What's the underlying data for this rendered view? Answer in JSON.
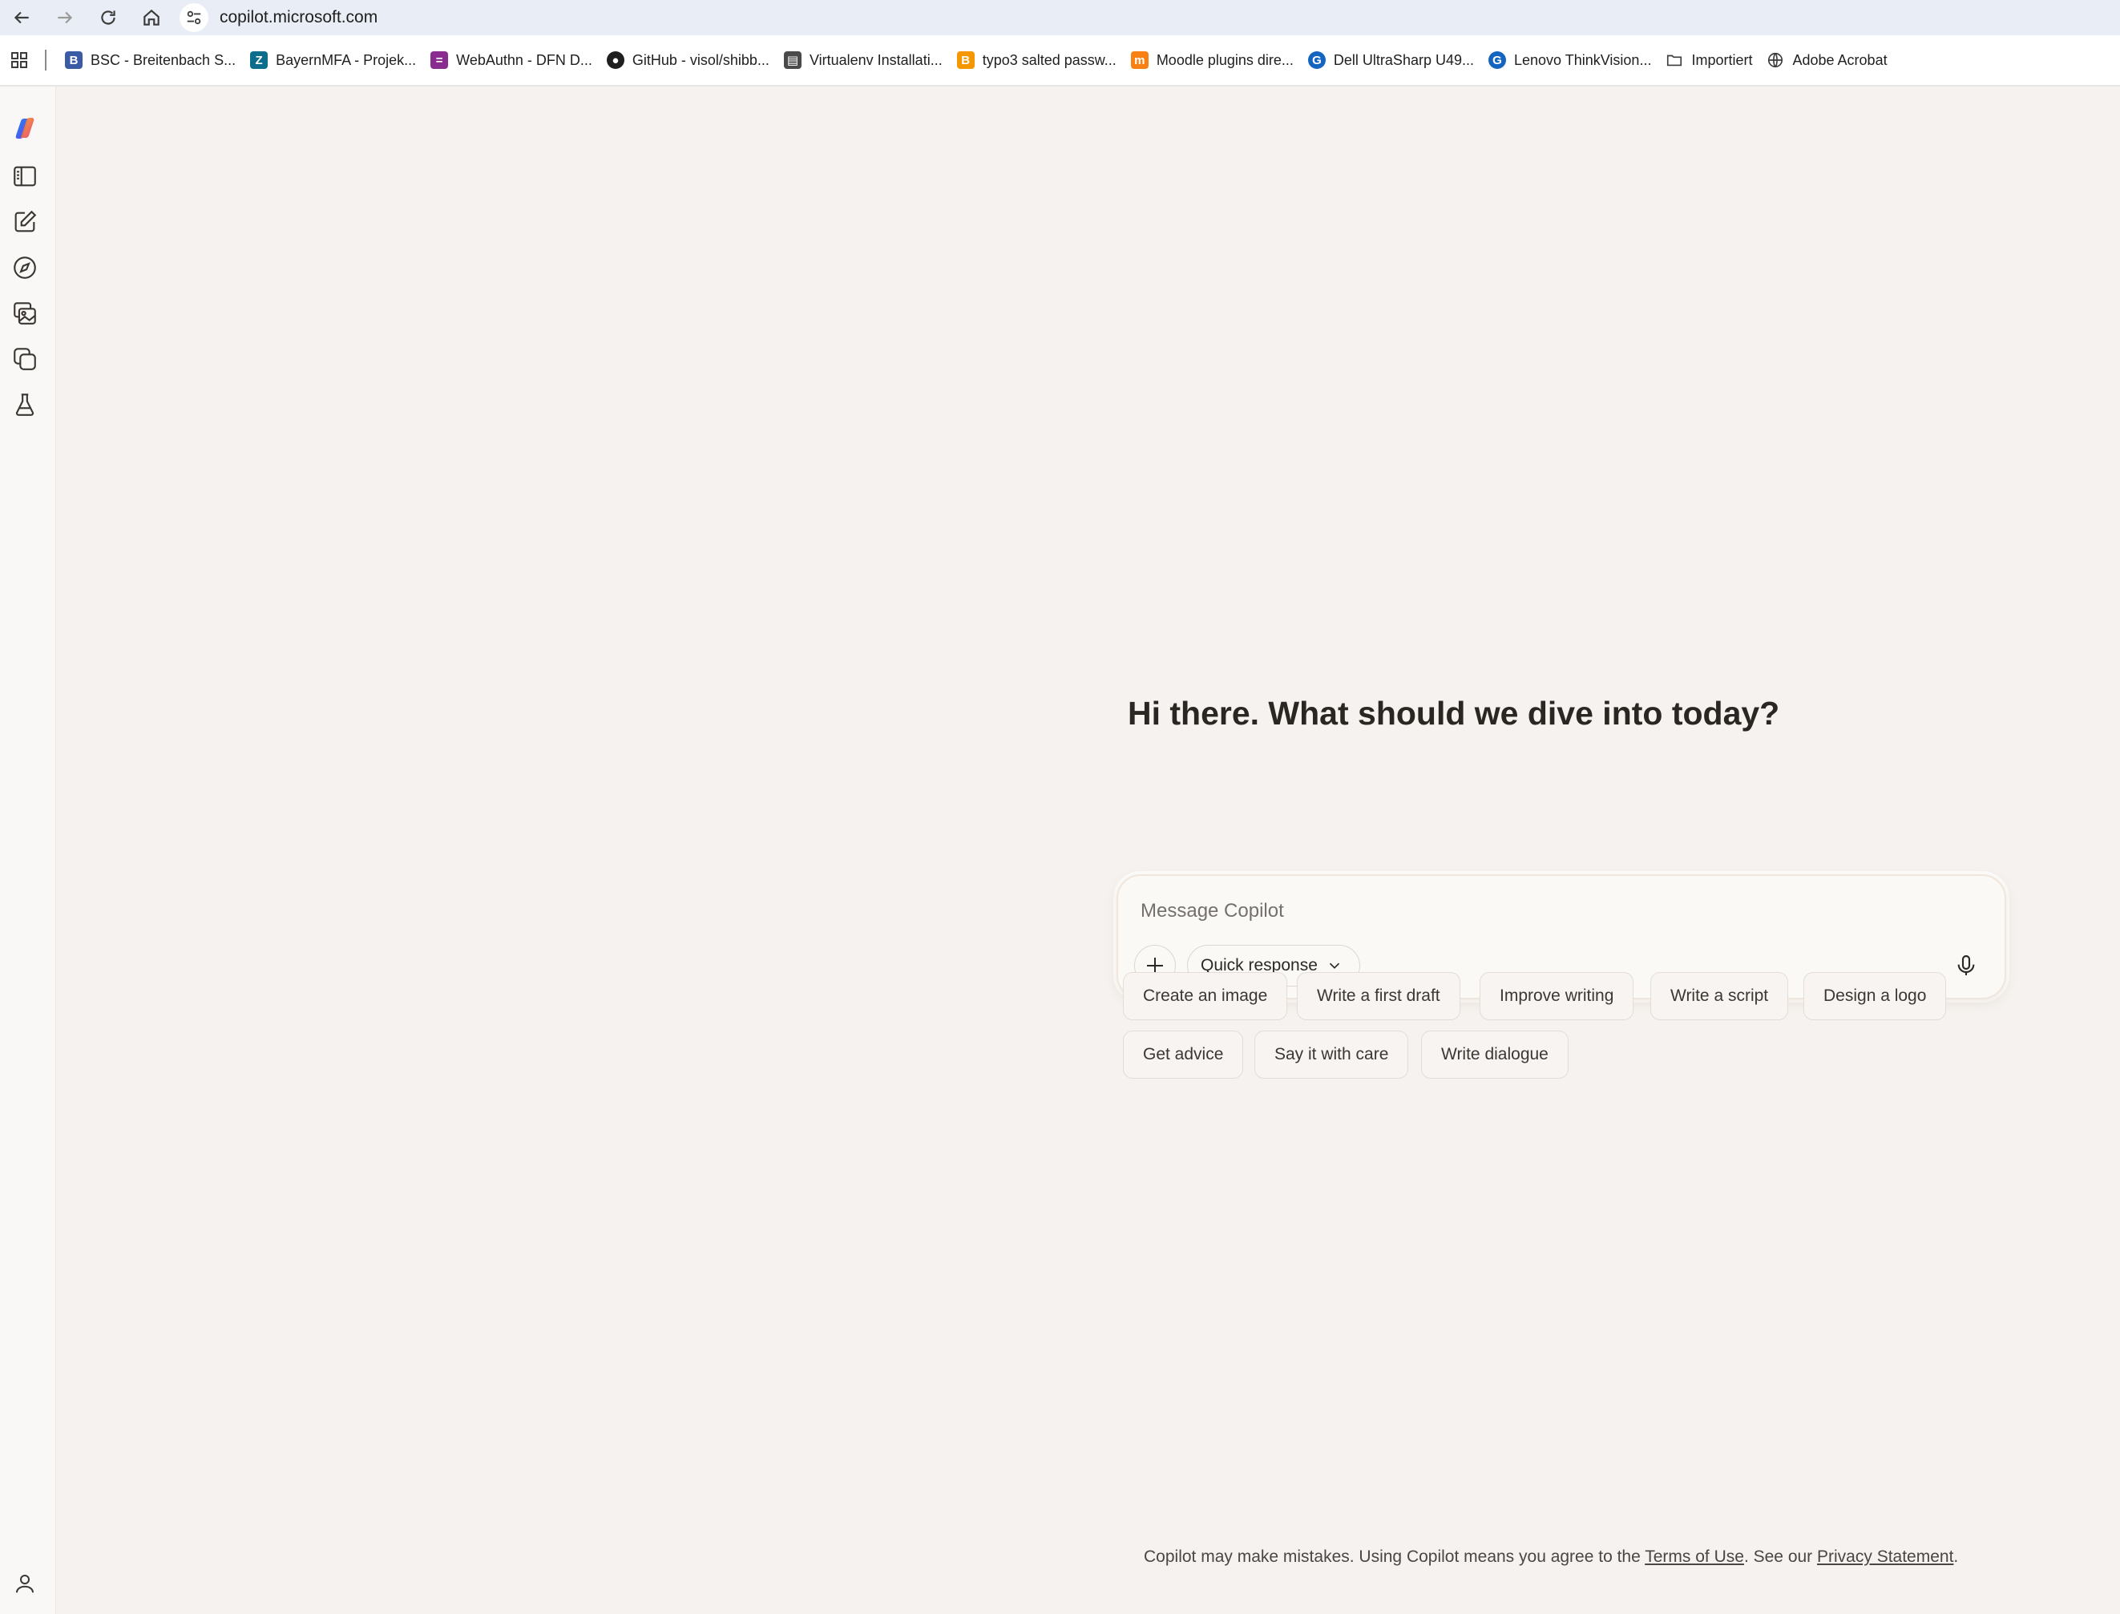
{
  "browser": {
    "url": "copilot.microsoft.com",
    "nav_icons": [
      "back-arrow-icon",
      "forward-arrow-icon",
      "reload-icon",
      "home-icon",
      "site-info-icon"
    ],
    "bookmarks": [
      {
        "label": "BSC - Breitenbach S...",
        "favicon": "bsc-favicon",
        "color": "#3b5ba5",
        "glyph": "B"
      },
      {
        "label": "BayernMFA - Projek...",
        "favicon": "bayernmfa-favicon",
        "color": "#0c6e8c",
        "glyph": "Z"
      },
      {
        "label": "WebAuthn  - DFN D...",
        "favicon": "dfn-favicon",
        "color": "#8a2c8f",
        "glyph": "="
      },
      {
        "label": "GitHub - visol/shibb...",
        "favicon": "github-favicon",
        "color": "#1f1f1f",
        "glyph": "●"
      },
      {
        "label": "Virtualenv Installati...",
        "favicon": "virtualenv-favicon",
        "color": "#4a4a4a",
        "glyph": "▤"
      },
      {
        "label": "typo3 salted passw...",
        "favicon": "typo3-favicon",
        "color": "#f49700",
        "glyph": "B"
      },
      {
        "label": "Moodle plugins dire...",
        "favicon": "moodle-favicon",
        "color": "#f98012",
        "glyph": "m"
      },
      {
        "label": "Dell UltraSharp U49...",
        "favicon": "geizhals-favicon",
        "color": "#1565c0",
        "glyph": "G"
      },
      {
        "label": "Lenovo ThinkVision...",
        "favicon": "geizhals-favicon",
        "color": "#1565c0",
        "glyph": "G"
      },
      {
        "label": "Importiert",
        "favicon": "folder-icon",
        "color": "#ffffff",
        "glyph": ""
      },
      {
        "label": "Adobe Acrobat",
        "favicon": "globe-icon",
        "color": "#ffffff",
        "glyph": ""
      }
    ]
  },
  "sidebar": {
    "items": [
      {
        "name": "copilot-logo-icon"
      },
      {
        "name": "sidebar-toggle-icon"
      },
      {
        "name": "new-chat-icon"
      },
      {
        "name": "discover-icon"
      },
      {
        "name": "image-gallery-icon"
      },
      {
        "name": "pages-icon"
      },
      {
        "name": "labs-flask-icon"
      }
    ],
    "profile_icon": "profile-icon"
  },
  "main": {
    "headline": "Hi there. What should we dive into today?",
    "composer": {
      "placeholder": "Message Copilot",
      "value": "",
      "mode_label": "Quick response",
      "plus_icon": "plus-icon",
      "mic_icon": "microphone-icon"
    },
    "suggestions": [
      "Create an image",
      "Write a first draft",
      "Improve writing",
      "Write a script",
      "Design a logo",
      "Get advice",
      "Say it with care",
      "Write dialogue"
    ],
    "footer": {
      "text_before": "Copilot may make mistakes. Using Copilot means you agree to the ",
      "terms_link": "Terms of Use",
      "text_middle": ". See our ",
      "privacy_link": "Privacy Statement",
      "text_after": "."
    }
  },
  "colors": {
    "page_bg": "#f5f2ef",
    "address_bar_bg": "#e9eef6",
    "text": "#2a2622"
  }
}
